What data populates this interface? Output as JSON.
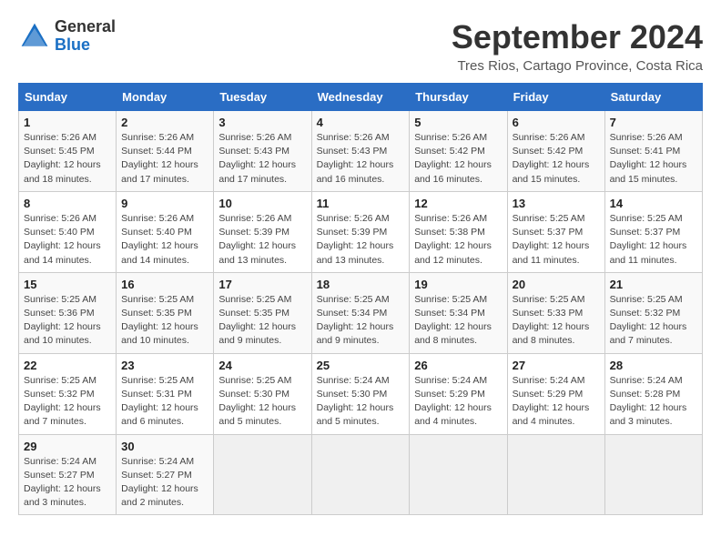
{
  "logo": {
    "line1": "General",
    "line2": "Blue"
  },
  "title": "September 2024",
  "location": "Tres Rios, Cartago Province, Costa Rica",
  "headers": [
    "Sunday",
    "Monday",
    "Tuesday",
    "Wednesday",
    "Thursday",
    "Friday",
    "Saturday"
  ],
  "weeks": [
    [
      {
        "day": "1",
        "sunrise": "5:26 AM",
        "sunset": "5:45 PM",
        "daylight": "12 hours and 18 minutes."
      },
      {
        "day": "2",
        "sunrise": "5:26 AM",
        "sunset": "5:44 PM",
        "daylight": "12 hours and 17 minutes."
      },
      {
        "day": "3",
        "sunrise": "5:26 AM",
        "sunset": "5:43 PM",
        "daylight": "12 hours and 17 minutes."
      },
      {
        "day": "4",
        "sunrise": "5:26 AM",
        "sunset": "5:43 PM",
        "daylight": "12 hours and 16 minutes."
      },
      {
        "day": "5",
        "sunrise": "5:26 AM",
        "sunset": "5:42 PM",
        "daylight": "12 hours and 16 minutes."
      },
      {
        "day": "6",
        "sunrise": "5:26 AM",
        "sunset": "5:42 PM",
        "daylight": "12 hours and 15 minutes."
      },
      {
        "day": "7",
        "sunrise": "5:26 AM",
        "sunset": "5:41 PM",
        "daylight": "12 hours and 15 minutes."
      }
    ],
    [
      {
        "day": "8",
        "sunrise": "5:26 AM",
        "sunset": "5:40 PM",
        "daylight": "12 hours and 14 minutes."
      },
      {
        "day": "9",
        "sunrise": "5:26 AM",
        "sunset": "5:40 PM",
        "daylight": "12 hours and 14 minutes."
      },
      {
        "day": "10",
        "sunrise": "5:26 AM",
        "sunset": "5:39 PM",
        "daylight": "12 hours and 13 minutes."
      },
      {
        "day": "11",
        "sunrise": "5:26 AM",
        "sunset": "5:39 PM",
        "daylight": "12 hours and 13 minutes."
      },
      {
        "day": "12",
        "sunrise": "5:26 AM",
        "sunset": "5:38 PM",
        "daylight": "12 hours and 12 minutes."
      },
      {
        "day": "13",
        "sunrise": "5:25 AM",
        "sunset": "5:37 PM",
        "daylight": "12 hours and 11 minutes."
      },
      {
        "day": "14",
        "sunrise": "5:25 AM",
        "sunset": "5:37 PM",
        "daylight": "12 hours and 11 minutes."
      }
    ],
    [
      {
        "day": "15",
        "sunrise": "5:25 AM",
        "sunset": "5:36 PM",
        "daylight": "12 hours and 10 minutes."
      },
      {
        "day": "16",
        "sunrise": "5:25 AM",
        "sunset": "5:35 PM",
        "daylight": "12 hours and 10 minutes."
      },
      {
        "day": "17",
        "sunrise": "5:25 AM",
        "sunset": "5:35 PM",
        "daylight": "12 hours and 9 minutes."
      },
      {
        "day": "18",
        "sunrise": "5:25 AM",
        "sunset": "5:34 PM",
        "daylight": "12 hours and 9 minutes."
      },
      {
        "day": "19",
        "sunrise": "5:25 AM",
        "sunset": "5:34 PM",
        "daylight": "12 hours and 8 minutes."
      },
      {
        "day": "20",
        "sunrise": "5:25 AM",
        "sunset": "5:33 PM",
        "daylight": "12 hours and 8 minutes."
      },
      {
        "day": "21",
        "sunrise": "5:25 AM",
        "sunset": "5:32 PM",
        "daylight": "12 hours and 7 minutes."
      }
    ],
    [
      {
        "day": "22",
        "sunrise": "5:25 AM",
        "sunset": "5:32 PM",
        "daylight": "12 hours and 7 minutes."
      },
      {
        "day": "23",
        "sunrise": "5:25 AM",
        "sunset": "5:31 PM",
        "daylight": "12 hours and 6 minutes."
      },
      {
        "day": "24",
        "sunrise": "5:25 AM",
        "sunset": "5:30 PM",
        "daylight": "12 hours and 5 minutes."
      },
      {
        "day": "25",
        "sunrise": "5:24 AM",
        "sunset": "5:30 PM",
        "daylight": "12 hours and 5 minutes."
      },
      {
        "day": "26",
        "sunrise": "5:24 AM",
        "sunset": "5:29 PM",
        "daylight": "12 hours and 4 minutes."
      },
      {
        "day": "27",
        "sunrise": "5:24 AM",
        "sunset": "5:29 PM",
        "daylight": "12 hours and 4 minutes."
      },
      {
        "day": "28",
        "sunrise": "5:24 AM",
        "sunset": "5:28 PM",
        "daylight": "12 hours and 3 minutes."
      }
    ],
    [
      {
        "day": "29",
        "sunrise": "5:24 AM",
        "sunset": "5:27 PM",
        "daylight": "12 hours and 3 minutes."
      },
      {
        "day": "30",
        "sunrise": "5:24 AM",
        "sunset": "5:27 PM",
        "daylight": "12 hours and 2 minutes."
      },
      null,
      null,
      null,
      null,
      null
    ]
  ],
  "labels": {
    "sunrise": "Sunrise:",
    "sunset": "Sunset:",
    "daylight": "Daylight:"
  }
}
